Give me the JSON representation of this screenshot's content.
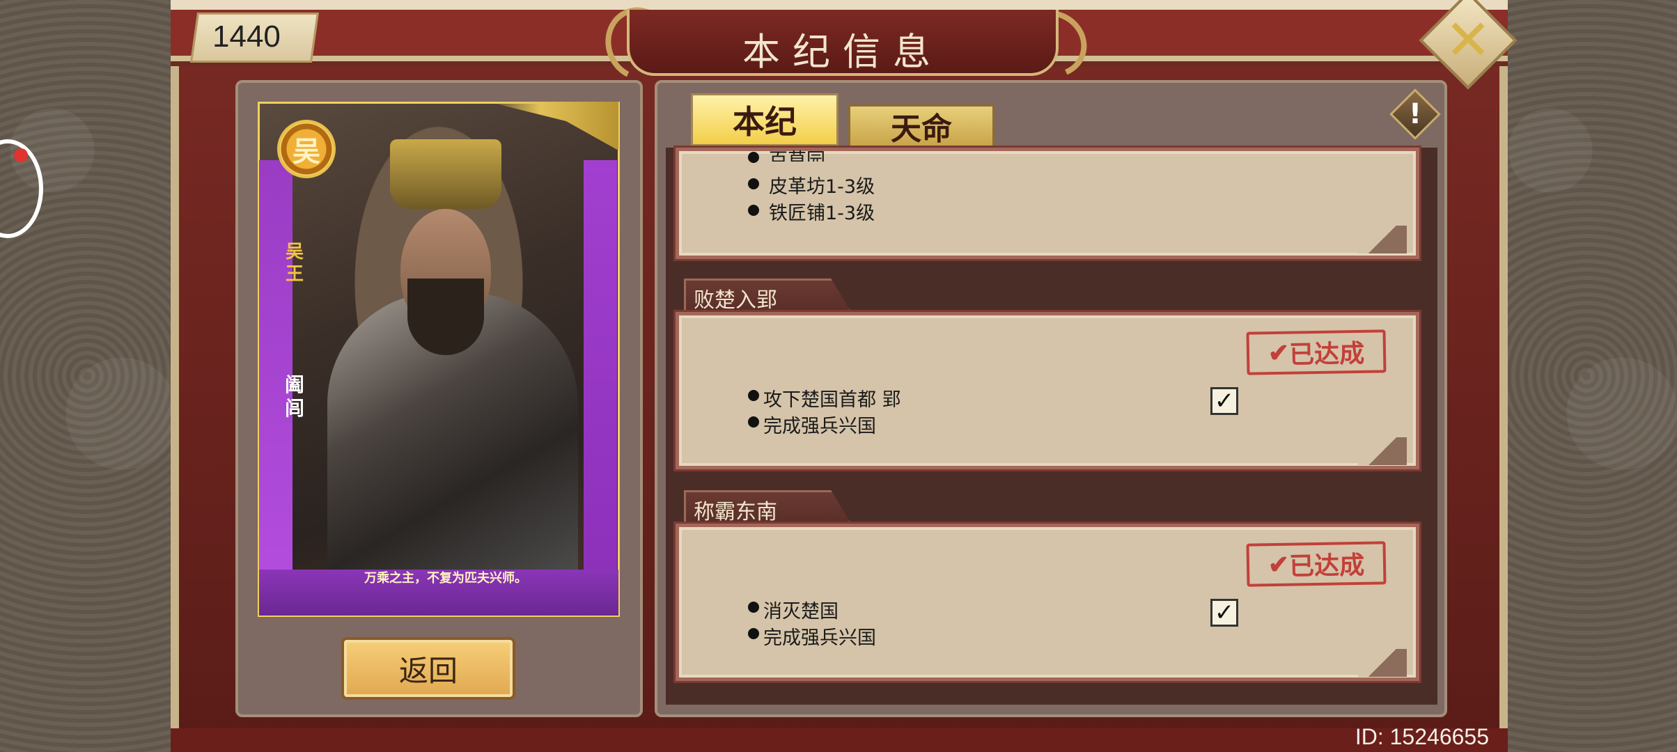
{
  "header": {
    "counter": "1440",
    "title": "本纪信息",
    "close_icon": "close-x-icon"
  },
  "left_panel": {
    "kingdom_badge": "吴",
    "rank_text": "吴王",
    "character_name": "阖闾",
    "quote": "万乘之主，不复为匹夫兴师。",
    "back_button": "返回"
  },
  "tabs": [
    {
      "label": "本纪",
      "active": true
    },
    {
      "label": "天命",
      "active": false
    }
  ],
  "warning_icon": "exclamation-icon",
  "sections": [
    {
      "title": "",
      "items": [
        "皮革坊1-3级",
        "铁匠铺1-3级"
      ],
      "partial_item": "百草园",
      "completed": false
    },
    {
      "title": "败楚入郢",
      "items": [
        "攻下楚国首都 郢",
        "完成强兵兴国"
      ],
      "stamp": "已达成",
      "completed": true
    },
    {
      "title": "称霸东南",
      "items": [
        "消灭楚国",
        "完成强兵兴国"
      ],
      "stamp": "已达成",
      "completed": true
    }
  ],
  "footer": {
    "id_text": "ID: 15246655"
  },
  "colors": {
    "frame_red": "#7a2a24",
    "card_paper": "#d5c4a9",
    "stamp_red": "#c2403a",
    "gold": "#f2cf4a"
  }
}
